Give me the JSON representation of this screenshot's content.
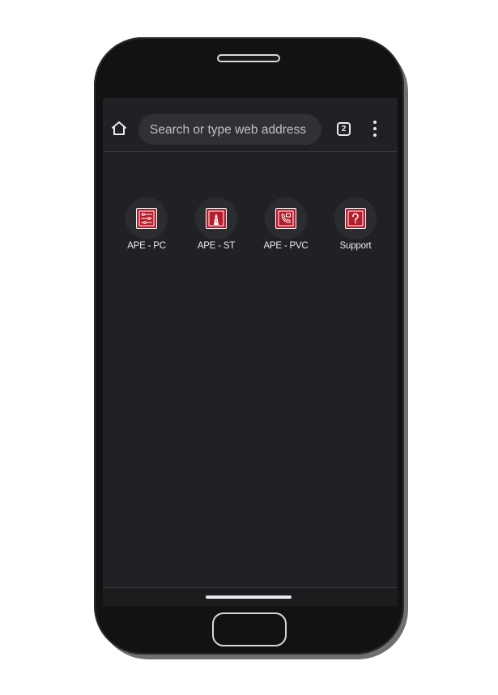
{
  "browser": {
    "search": {
      "placeholder": "Search or type web address",
      "value": ""
    },
    "tab_count": "2"
  },
  "shortcuts": [
    {
      "label": "APE - PC",
      "icon": "sliders-icon"
    },
    {
      "label": "APE - ST",
      "icon": "road-icon"
    },
    {
      "label": "APE - PVC",
      "icon": "phone-call-icon"
    },
    {
      "label": "Support",
      "icon": "question-icon"
    }
  ],
  "colors": {
    "screen_bg": "#202124",
    "search_bg": "#303134",
    "badge_red": "#b71c2b",
    "phone_body": "#121212"
  }
}
